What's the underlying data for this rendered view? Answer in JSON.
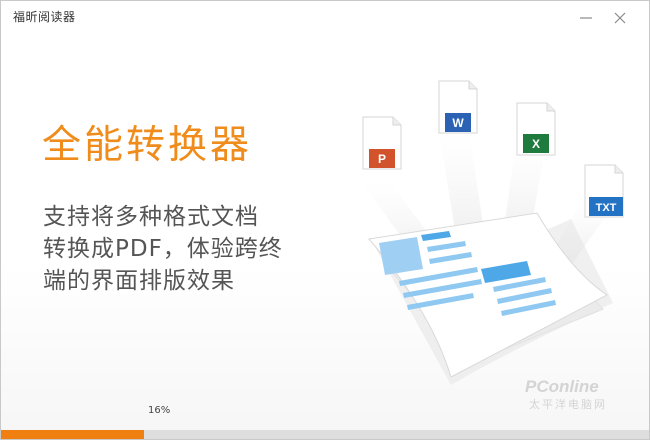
{
  "window": {
    "title": "福昕阅读器"
  },
  "hero": {
    "headline": "全能转换器",
    "description_lines": [
      "支持将多种格式文档",
      "转换成PDF，体验跨终",
      "端的界面排版效果"
    ]
  },
  "formats": {
    "ppt": "P",
    "word": "W",
    "excel": "X",
    "txt": "TXT"
  },
  "progress": {
    "label": "16%",
    "fraction": 0.22
  },
  "watermark": {
    "brand": "PConline",
    "cn": "太平洋电脑网"
  },
  "colors": {
    "accent": "#f08c1c",
    "progress": "#f07f12",
    "ppt": "#d2522c",
    "word": "#2b62b3",
    "excel": "#1f7a3e",
    "txt": "#2372c4",
    "doc_blue": "#4ea8e8"
  }
}
